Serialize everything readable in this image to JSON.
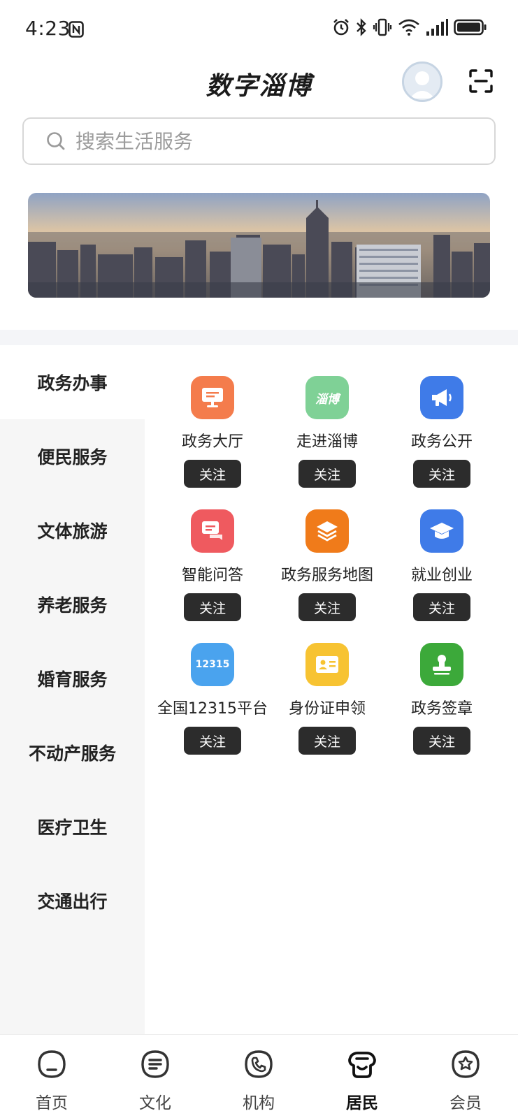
{
  "status_bar": {
    "time": "4:23"
  },
  "header": {
    "title": "数字淄博"
  },
  "search": {
    "placeholder": "搜索生活服务"
  },
  "side_nav": {
    "items": [
      {
        "label": "政务办事"
      },
      {
        "label": "便民服务"
      },
      {
        "label": "文体旅游"
      },
      {
        "label": "养老服务"
      },
      {
        "label": "婚育服务"
      },
      {
        "label": "不动产服务"
      },
      {
        "label": "医疗卫生"
      },
      {
        "label": "交通出行"
      }
    ],
    "active_index": 0
  },
  "services": {
    "follow_label": "关注",
    "items": [
      {
        "label": "政务大厅",
        "icon": "monitor-icon",
        "color": "#f47c4c"
      },
      {
        "label": "走进淄博",
        "icon": "zibo-logo-icon",
        "icon_text": "淄博",
        "color": "#7fd196"
      },
      {
        "label": "政务公开",
        "icon": "megaphone-icon",
        "color": "#3f7be8"
      },
      {
        "label": "智能问答",
        "icon": "chat-icon",
        "color": "#ef5a5f"
      },
      {
        "label": "政务服务地图",
        "icon": "layers-icon",
        "color": "#f07b1a"
      },
      {
        "label": "就业创业",
        "icon": "graduation-cap-icon",
        "color": "#3f7be8"
      },
      {
        "label": "全国12315平台",
        "icon": "12315-icon",
        "icon_text": "12315",
        "color": "#4aa3ee"
      },
      {
        "label": "身份证申领",
        "icon": "id-card-icon",
        "color": "#f7c332"
      },
      {
        "label": "政务签章",
        "icon": "stamp-icon",
        "color": "#3ca93a"
      }
    ]
  },
  "bottom_nav": {
    "tabs": [
      {
        "label": "首页",
        "icon": "home-icon"
      },
      {
        "label": "文化",
        "icon": "culture-icon"
      },
      {
        "label": "机构",
        "icon": "phone-icon"
      },
      {
        "label": "居民",
        "icon": "residents-icon"
      },
      {
        "label": "会员",
        "icon": "member-icon"
      }
    ],
    "active_index": 3
  }
}
